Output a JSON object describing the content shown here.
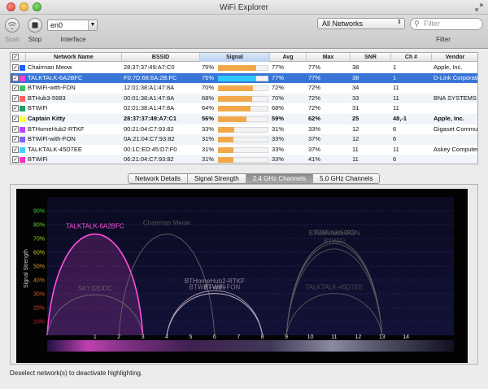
{
  "window": {
    "title": "WiFi Explorer"
  },
  "toolbar": {
    "scan_label": "Scan",
    "stop_label": "Stop",
    "interface_value": "en0",
    "interface_label": "Interface",
    "networks_filter": "All Networks",
    "search_placeholder": "Filter",
    "filter_label": "Filter"
  },
  "table": {
    "columns": [
      "Network Name",
      "BSSID",
      "Signal",
      "Avg",
      "Max",
      "SNR",
      "Ch #",
      "Vendor"
    ],
    "rows": [
      {
        "color": "#2060ff",
        "name": "Chairman Meow",
        "bssid": "28:37:37:49:A7:C0",
        "signal": "75%",
        "signal_value": 75,
        "avg": "77%",
        "max": "77%",
        "snr": "38",
        "ch": "1",
        "vendor": "Apple, Inc."
      },
      {
        "color": "#ff40d0",
        "name": "TALKTALK-6A2BFC",
        "bssid": "F0:7D:68:6A:2B:FC",
        "signal": "75%",
        "signal_value": 75,
        "avg": "77%",
        "max": "77%",
        "snr": "38",
        "ch": "1",
        "vendor": "D-Link Corporation"
      },
      {
        "color": "#40c060",
        "name": "BTWiFi-with-FON",
        "bssid": "12:01:38:A1:47:8A",
        "signal": "70%",
        "signal_value": 70,
        "avg": "72%",
        "max": "72%",
        "snr": "34",
        "ch": "11",
        "vendor": ""
      },
      {
        "color": "#ff6060",
        "name": "BTHub3-5983",
        "bssid": "00:01:38:A1:47:8A",
        "signal": "68%",
        "signal_value": 68,
        "avg": "70%",
        "max": "72%",
        "snr": "33",
        "ch": "11",
        "vendor": "BNA SYSTEMS"
      },
      {
        "color": "#20a060",
        "name": "BTWiFi",
        "bssid": "02:01:38:A1:47:8A",
        "signal": "64%",
        "signal_value": 64,
        "avg": "68%",
        "max": "72%",
        "snr": "31",
        "ch": "11",
        "vendor": ""
      },
      {
        "color": "#ffff40",
        "name": "Captain Kitty",
        "bssid": "28:37:37:49:A7:C1",
        "signal": "56%",
        "signal_value": 56,
        "avg": "59%",
        "max": "62%",
        "snr": "25",
        "ch": "48,-1",
        "vendor": "Apple, Inc."
      },
      {
        "color": "#c040ff",
        "name": "BTHomeHub2-RTKF",
        "bssid": "00:21:04:C7:93:82",
        "signal": "33%",
        "signal_value": 33,
        "avg": "31%",
        "max": "33%",
        "snr": "12",
        "ch": "6",
        "vendor": "Gigaset Communications"
      },
      {
        "color": "#8060ff",
        "name": "BTWiFi-with-FON",
        "bssid": "0A:21:04:C7:93:82",
        "signal": "31%",
        "signal_value": 31,
        "avg": "33%",
        "max": "37%",
        "snr": "12",
        "ch": "6",
        "vendor": ""
      },
      {
        "color": "#40d0ff",
        "name": "TALKTALK-45D7EE",
        "bssid": "00:1C:ED:45:D7:F0",
        "signal": "31%",
        "signal_value": 31,
        "avg": "33%",
        "max": "37%",
        "snr": "11",
        "ch": "11",
        "vendor": "Askey Computer"
      },
      {
        "color": "#ff30c0",
        "name": "BTWiFi",
        "bssid": "06:21:04:C7:93:82",
        "signal": "31%",
        "signal_value": 31,
        "avg": "33%",
        "max": "41%",
        "snr": "11",
        "ch": "6",
        "vendor": ""
      }
    ]
  },
  "tabs": [
    "Network Details",
    "Signal Strength",
    "2.4 GHz Channels",
    "5.0 GHz Channels"
  ],
  "active_tab": 2,
  "chart_data": {
    "type": "area",
    "ylabel": "Signal Strength",
    "xlabel": "",
    "y_ticks": [
      "90%",
      "80%",
      "70%",
      "60%",
      "50%",
      "40%",
      "30%",
      "20%",
      "10%"
    ],
    "ylim": [
      0,
      100
    ],
    "x_ticks": [
      "1",
      "2",
      "3",
      "4",
      "5",
      "6",
      "7",
      "8",
      "9",
      "10",
      "11",
      "12",
      "13",
      "14"
    ],
    "xlim": [
      -1,
      16
    ],
    "series": [
      {
        "name": "TALKTALK-6A2BFC",
        "channel": 1,
        "value": 75,
        "color": "#ff50e0",
        "highlight": true
      },
      {
        "name": "Chairman Meow",
        "channel": 4,
        "value": 75,
        "color": "#6a6a6a",
        "highlight": false
      },
      {
        "name": "SKY32DDC",
        "channel": 1,
        "value": 30,
        "color": "#707070",
        "highlight": false
      },
      {
        "name": "BTWiFi-with-FON",
        "channel": 11,
        "value": 70,
        "color": "#707070",
        "highlight": false
      },
      {
        "name": "BTHub3-5983",
        "channel": 11,
        "value": 68,
        "color": "#606060",
        "highlight": false
      },
      {
        "name": "BTWiFi",
        "channel": 11,
        "value": 64,
        "color": "#5a5a5a",
        "highlight": false
      },
      {
        "name": "TALKTALK-45D7EE",
        "channel": 11,
        "value": 31,
        "color": "#606060",
        "highlight": false
      },
      {
        "name": "BTHomeHub2-RTKF",
        "channel": 6,
        "value": 33,
        "color": "#b8a8b8",
        "highlight": false
      },
      {
        "name": "BTWiFi-with-FON",
        "channel": 6,
        "value": 31,
        "color": "#a894a8",
        "highlight": false
      },
      {
        "name": "BTWiFi",
        "channel": 6,
        "value": 31,
        "color": "#c0b0c0",
        "highlight": false
      }
    ],
    "grid": true,
    "legend": "none"
  },
  "status": {
    "text": "Deselect network(s) to deactivate highlighting."
  }
}
